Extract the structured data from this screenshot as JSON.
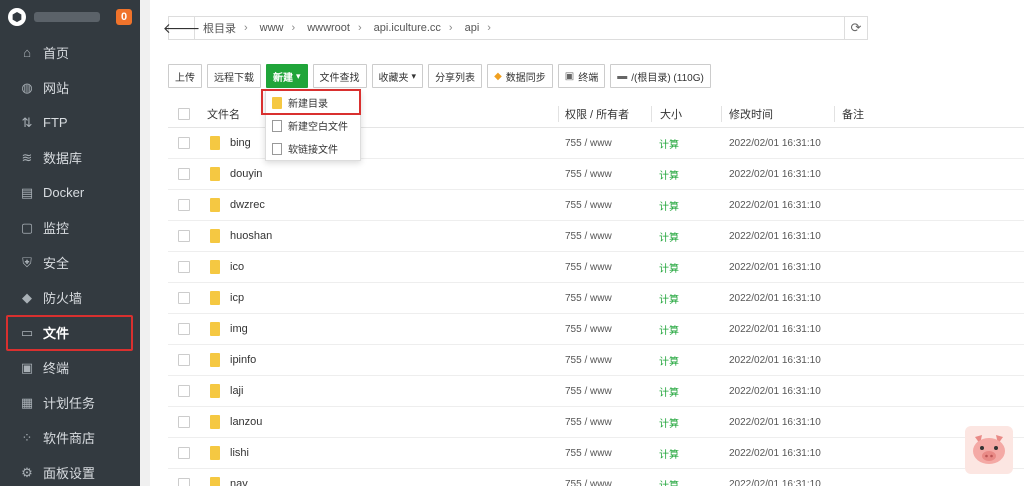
{
  "sidebar": {
    "logo_glyph": "⬢",
    "badge": "0",
    "items": [
      {
        "label": "首页",
        "icon": "home-icon"
      },
      {
        "label": "网站",
        "icon": "globe-icon"
      },
      {
        "label": "FTP",
        "icon": "ftp-icon"
      },
      {
        "label": "数据库",
        "icon": "database-icon"
      },
      {
        "label": "Docker",
        "icon": "docker-icon"
      },
      {
        "label": "监控",
        "icon": "monitor-icon"
      },
      {
        "label": "安全",
        "icon": "shield-icon"
      },
      {
        "label": "防火墙",
        "icon": "firewall-icon"
      },
      {
        "label": "文件",
        "icon": "folder-icon"
      },
      {
        "label": "终端",
        "icon": "terminal-icon"
      },
      {
        "label": "计划任务",
        "icon": "calendar-icon"
      },
      {
        "label": "软件商店",
        "icon": "grid-icon"
      },
      {
        "label": "面板设置",
        "icon": "gear-icon"
      }
    ],
    "active_index": 8,
    "accent_color": "#d9302f"
  },
  "path": {
    "back_glyph": "🡐",
    "crumbs": [
      "根目录",
      "www",
      "wwwroot",
      "api.iculture.cc",
      "api"
    ],
    "refresh_glyph": "⟳"
  },
  "toolbar": {
    "upload": "上传",
    "remote_download": "远程下载",
    "new": "新建",
    "file_search": "文件查找",
    "favorites": "收藏夹",
    "share_list": "分享列表",
    "data_sync": "数据同步",
    "terminal": "终端",
    "disk": "/(根目录) (110G)"
  },
  "new_menu": {
    "items": [
      "新建目录",
      "新建空白文件",
      "软链接文件"
    ]
  },
  "table": {
    "headers": {
      "name": "文件名",
      "perm": "权限 / 所有者",
      "size": "大小",
      "mtime": "修改时间",
      "note": "备注"
    },
    "rows": [
      {
        "name": "bing",
        "perm": "755 / www",
        "size": "计算",
        "mtime": "2022/02/01 16:31:10"
      },
      {
        "name": "douyin",
        "perm": "755 / www",
        "size": "计算",
        "mtime": "2022/02/01 16:31:10"
      },
      {
        "name": "dwzrec",
        "perm": "755 / www",
        "size": "计算",
        "mtime": "2022/02/01 16:31:10"
      },
      {
        "name": "huoshan",
        "perm": "755 / www",
        "size": "计算",
        "mtime": "2022/02/01 16:31:10"
      },
      {
        "name": "ico",
        "perm": "755 / www",
        "size": "计算",
        "mtime": "2022/02/01 16:31:10"
      },
      {
        "name": "icp",
        "perm": "755 / www",
        "size": "计算",
        "mtime": "2022/02/01 16:31:10"
      },
      {
        "name": "img",
        "perm": "755 / www",
        "size": "计算",
        "mtime": "2022/02/01 16:31:10"
      },
      {
        "name": "ipinfo",
        "perm": "755 / www",
        "size": "计算",
        "mtime": "2022/02/01 16:31:10"
      },
      {
        "name": "laji",
        "perm": "755 / www",
        "size": "计算",
        "mtime": "2022/02/01 16:31:10"
      },
      {
        "name": "lanzou",
        "perm": "755 / www",
        "size": "计算",
        "mtime": "2022/02/01 16:31:10"
      },
      {
        "name": "lishi",
        "perm": "755 / www",
        "size": "计算",
        "mtime": "2022/02/01 16:31:10"
      },
      {
        "name": "nav",
        "perm": "755 / www",
        "size": "计算",
        "mtime": "2022/02/01 16:31:10"
      }
    ]
  }
}
